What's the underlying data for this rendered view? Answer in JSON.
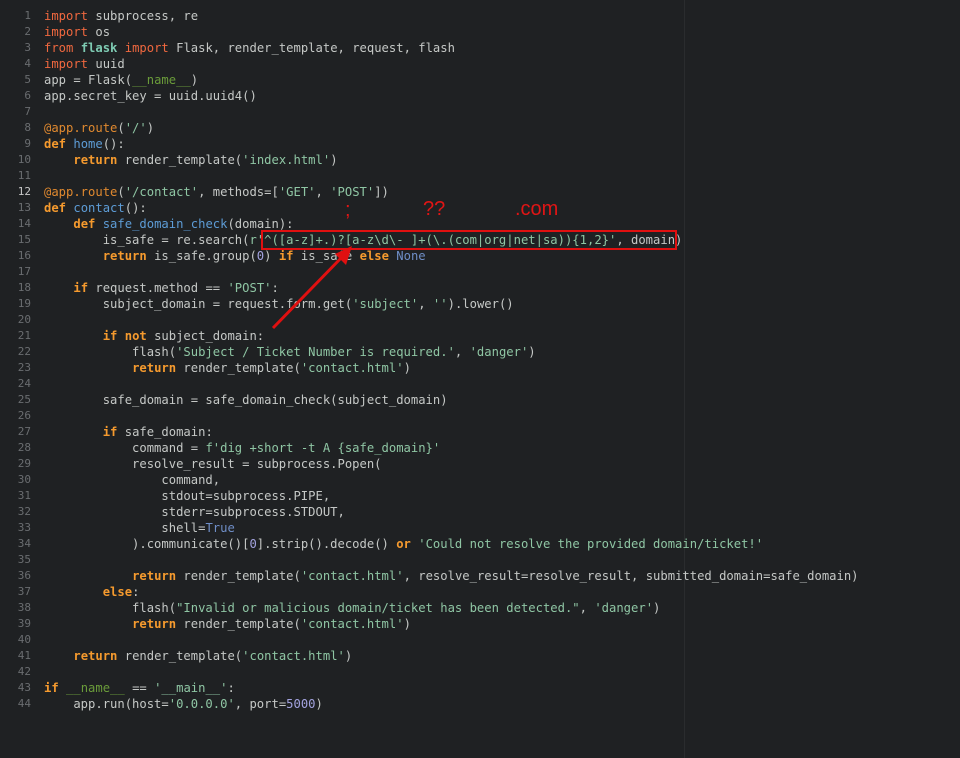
{
  "editor": {
    "active_line": 12,
    "lines": [
      {
        "n": "1",
        "tokens": [
          [
            "import",
            "kw2"
          ],
          [
            " subprocess, re",
            "plain"
          ]
        ]
      },
      {
        "n": "2",
        "tokens": [
          [
            "import",
            "kw2"
          ],
          [
            " os",
            "plain"
          ]
        ]
      },
      {
        "n": "3",
        "tokens": [
          [
            "from",
            "kw2"
          ],
          [
            " ",
            "plain"
          ],
          [
            "flask",
            "mod"
          ],
          [
            " ",
            "plain"
          ],
          [
            "import",
            "kw2"
          ],
          [
            " Flask, render_template, request, flash",
            "plain"
          ]
        ]
      },
      {
        "n": "4",
        "tokens": [
          [
            "import",
            "kw2"
          ],
          [
            " uuid",
            "plain"
          ]
        ]
      },
      {
        "n": "5",
        "tokens": [
          [
            "app = Flask(",
            "plain"
          ],
          [
            "__name__",
            "magic"
          ],
          [
            ")",
            "plain"
          ]
        ]
      },
      {
        "n": "6",
        "tokens": [
          [
            "app.secret_key = uuid.uuid4()",
            "plain"
          ]
        ]
      },
      {
        "n": "7",
        "tokens": []
      },
      {
        "n": "8",
        "tokens": [
          [
            "@app.route",
            "dec"
          ],
          [
            "(",
            "plain"
          ],
          [
            "'/'",
            "str"
          ],
          [
            ")",
            "plain"
          ]
        ]
      },
      {
        "n": "9",
        "tokens": [
          [
            "def",
            "kw"
          ],
          [
            " ",
            "plain"
          ],
          [
            "home",
            "fn"
          ],
          [
            "():",
            "plain"
          ]
        ]
      },
      {
        "n": "10",
        "tokens": [
          [
            "    ",
            "plain"
          ],
          [
            "return",
            "kw"
          ],
          [
            " render_template(",
            "plain"
          ],
          [
            "'index.html'",
            "str"
          ],
          [
            ")",
            "plain"
          ]
        ]
      },
      {
        "n": "11",
        "tokens": []
      },
      {
        "n": "12",
        "tokens": [
          [
            "@app.route",
            "dec"
          ],
          [
            "(",
            "plain"
          ],
          [
            "'/contact'",
            "str"
          ],
          [
            ", methods=[",
            "plain"
          ],
          [
            "'GET'",
            "str"
          ],
          [
            ", ",
            "plain"
          ],
          [
            "'POST'",
            "str"
          ],
          [
            "])",
            "plain"
          ]
        ]
      },
      {
        "n": "13",
        "tokens": [
          [
            "def",
            "kw"
          ],
          [
            " ",
            "plain"
          ],
          [
            "contact",
            "fn"
          ],
          [
            "():",
            "plain"
          ]
        ]
      },
      {
        "n": "14",
        "tokens": [
          [
            "    ",
            "plain"
          ],
          [
            "def",
            "kw"
          ],
          [
            " ",
            "plain"
          ],
          [
            "safe_domain_check",
            "fn"
          ],
          [
            "(domain):",
            "plain"
          ]
        ]
      },
      {
        "n": "15",
        "tokens": [
          [
            "        is_safe = re.search(",
            "plain"
          ],
          [
            "r'^([a-z]+.)?[a-z\\d\\- ]+(\\.(com|org|net|sa)){1,2}'",
            "str"
          ],
          [
            ", domain)",
            "plain"
          ]
        ]
      },
      {
        "n": "16",
        "tokens": [
          [
            "        ",
            "plain"
          ],
          [
            "return",
            "kw"
          ],
          [
            " is_safe.group(",
            "plain"
          ],
          [
            "0",
            "num"
          ],
          [
            ") ",
            "plain"
          ],
          [
            "if",
            "kw"
          ],
          [
            " is_safe ",
            "plain"
          ],
          [
            "else",
            "kw"
          ],
          [
            " ",
            "plain"
          ],
          [
            "None",
            "const"
          ]
        ]
      },
      {
        "n": "17",
        "tokens": []
      },
      {
        "n": "18",
        "tokens": [
          [
            "    ",
            "plain"
          ],
          [
            "if",
            "kw"
          ],
          [
            " request.method == ",
            "plain"
          ],
          [
            "'POST'",
            "str"
          ],
          [
            ":",
            "plain"
          ]
        ]
      },
      {
        "n": "19",
        "tokens": [
          [
            "        subject_domain = request.form.get(",
            "plain"
          ],
          [
            "'subject'",
            "str"
          ],
          [
            ", ",
            "plain"
          ],
          [
            "''",
            "str"
          ],
          [
            ").lower()",
            "plain"
          ]
        ]
      },
      {
        "n": "20",
        "tokens": []
      },
      {
        "n": "21",
        "tokens": [
          [
            "        ",
            "plain"
          ],
          [
            "if",
            "kw"
          ],
          [
            " ",
            "plain"
          ],
          [
            "not",
            "kw"
          ],
          [
            " subject_domain:",
            "plain"
          ]
        ]
      },
      {
        "n": "22",
        "tokens": [
          [
            "            flash(",
            "plain"
          ],
          [
            "'Subject / Ticket Number is required.'",
            "str"
          ],
          [
            ", ",
            "plain"
          ],
          [
            "'danger'",
            "str"
          ],
          [
            ")",
            "plain"
          ]
        ]
      },
      {
        "n": "23",
        "tokens": [
          [
            "            ",
            "plain"
          ],
          [
            "return",
            "kw"
          ],
          [
            " render_template(",
            "plain"
          ],
          [
            "'contact.html'",
            "str"
          ],
          [
            ")",
            "plain"
          ]
        ]
      },
      {
        "n": "24",
        "tokens": []
      },
      {
        "n": "25",
        "tokens": [
          [
            "        safe_domain = safe_domain_check(subject_domain)",
            "plain"
          ]
        ]
      },
      {
        "n": "26",
        "tokens": []
      },
      {
        "n": "27",
        "tokens": [
          [
            "        ",
            "plain"
          ],
          [
            "if",
            "kw"
          ],
          [
            " safe_domain:",
            "plain"
          ]
        ]
      },
      {
        "n": "28",
        "tokens": [
          [
            "            command = ",
            "plain"
          ],
          [
            "f'dig +short -t A {safe_domain}'",
            "str"
          ]
        ]
      },
      {
        "n": "29",
        "tokens": [
          [
            "            resolve_result = subprocess.Popen(",
            "plain"
          ]
        ]
      },
      {
        "n": "30",
        "tokens": [
          [
            "                command,",
            "plain"
          ]
        ]
      },
      {
        "n": "31",
        "tokens": [
          [
            "                stdout=subprocess.PIPE,",
            "plain"
          ]
        ]
      },
      {
        "n": "32",
        "tokens": [
          [
            "                stderr=subprocess.STDOUT,",
            "plain"
          ]
        ]
      },
      {
        "n": "33",
        "tokens": [
          [
            "                shell=",
            "plain"
          ],
          [
            "True",
            "const"
          ]
        ]
      },
      {
        "n": "34",
        "tokens": [
          [
            "            ).communicate()[",
            "plain"
          ],
          [
            "0",
            "num"
          ],
          [
            "].strip().decode() ",
            "plain"
          ],
          [
            "or",
            "kw"
          ],
          [
            " ",
            "plain"
          ],
          [
            "'Could not resolve the provided domain/ticket!'",
            "str"
          ]
        ]
      },
      {
        "n": "35",
        "tokens": []
      },
      {
        "n": "36",
        "tokens": [
          [
            "            ",
            "plain"
          ],
          [
            "return",
            "kw"
          ],
          [
            " render_template(",
            "plain"
          ],
          [
            "'contact.html'",
            "str"
          ],
          [
            ", resolve_result=resolve_result, submitted_domain=safe_domain)",
            "plain"
          ]
        ]
      },
      {
        "n": "37",
        "tokens": [
          [
            "        ",
            "plain"
          ],
          [
            "else",
            "kw"
          ],
          [
            ":",
            "plain"
          ]
        ]
      },
      {
        "n": "38",
        "tokens": [
          [
            "            flash(",
            "plain"
          ],
          [
            "\"Invalid or malicious domain/ticket has been detected.\"",
            "str"
          ],
          [
            ", ",
            "plain"
          ],
          [
            "'danger'",
            "str"
          ],
          [
            ")",
            "plain"
          ]
        ]
      },
      {
        "n": "39",
        "tokens": [
          [
            "            ",
            "plain"
          ],
          [
            "return",
            "kw"
          ],
          [
            " render_template(",
            "plain"
          ],
          [
            "'contact.html'",
            "str"
          ],
          [
            ")",
            "plain"
          ]
        ]
      },
      {
        "n": "40",
        "tokens": []
      },
      {
        "n": "41",
        "tokens": [
          [
            "    ",
            "plain"
          ],
          [
            "return",
            "kw"
          ],
          [
            " render_template(",
            "plain"
          ],
          [
            "'contact.html'",
            "str"
          ],
          [
            ")",
            "plain"
          ]
        ]
      },
      {
        "n": "42",
        "tokens": []
      },
      {
        "n": "43",
        "tokens": [
          [
            "if",
            "kw"
          ],
          [
            " ",
            "plain"
          ],
          [
            "__name__",
            "magic"
          ],
          [
            " == ",
            "plain"
          ],
          [
            "'__main__'",
            "str"
          ],
          [
            ":",
            "plain"
          ]
        ]
      },
      {
        "n": "44",
        "tokens": [
          [
            "    app.run(host=",
            "plain"
          ],
          [
            "'0.0.0.0'",
            "str"
          ],
          [
            ", port=",
            "plain"
          ],
          [
            "5000",
            "num"
          ],
          [
            ")",
            "plain"
          ]
        ]
      }
    ]
  },
  "annotations": {
    "semicolon_label": ";",
    "question_label": "??",
    "com_label": ".com",
    "color": "#e01010"
  }
}
